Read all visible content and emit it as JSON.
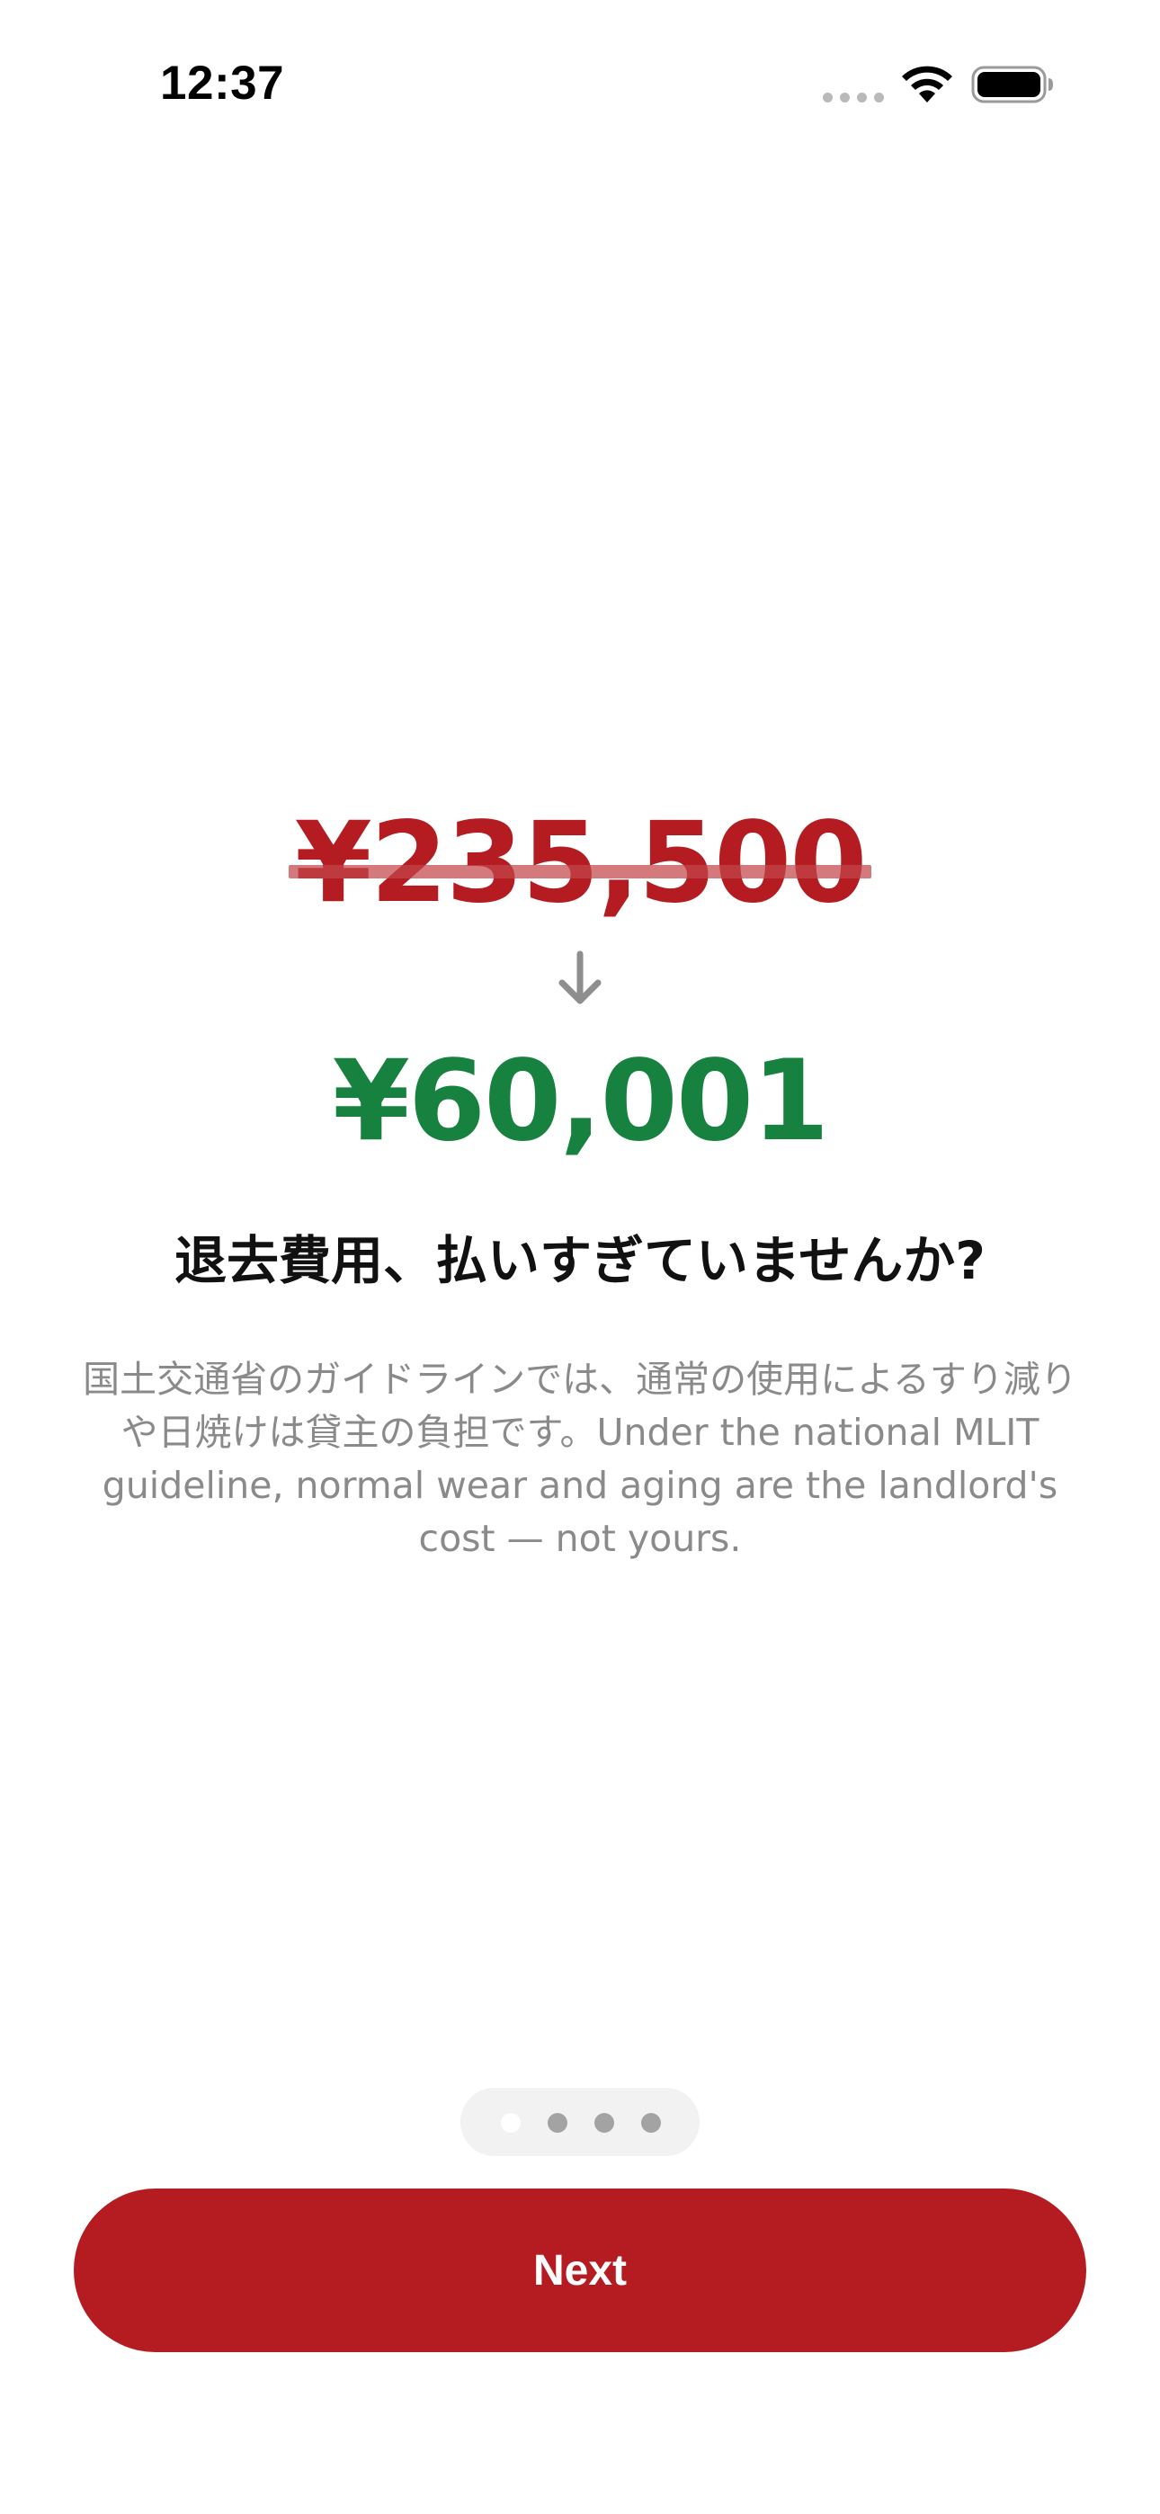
{
  "status_bar": {
    "time": "12:37",
    "icons": [
      "cellular-signal-icon",
      "wifi-icon",
      "battery-icon"
    ]
  },
  "onboarding": {
    "old_price": "¥235,500",
    "arrow_icon": "arrow-down-icon",
    "new_price": "¥60,001",
    "headline": "退去費用、払いすぎていませんか?",
    "body": "国土交通省のガイドラインでは、通常の使用によるすり減りや日焼けは貸主の負担です。Under the national MLIT guideline, normal wear and aging are the landlord's cost — not yours.",
    "page_indicator": {
      "total": 4,
      "current": 1
    },
    "next_label": "Next"
  },
  "colors": {
    "accent_red": "#b51c21",
    "strike_red": "#c4464a",
    "savings_green": "#178240",
    "muted_text": "#8a8a8a",
    "indicator_bg": "#f2f2f2"
  }
}
